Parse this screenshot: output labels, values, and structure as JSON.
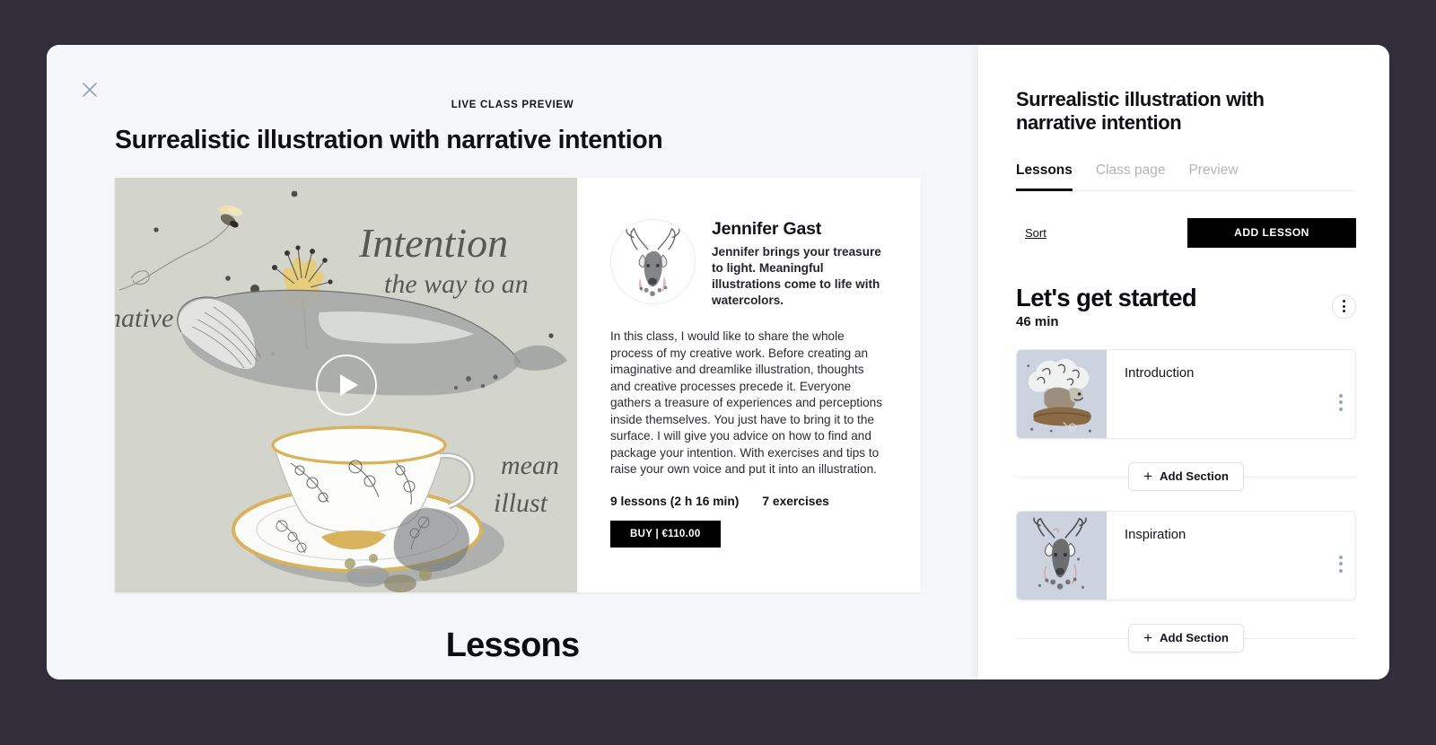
{
  "theme": {
    "page_background": "#312e3a",
    "modal_background": "#f4f6f9",
    "panel_background": "#ffffff",
    "accent": "#000000",
    "muted_text": "#b2b5bd",
    "hero_background": "#d3d4cc"
  },
  "preview": {
    "close_icon": "close-icon",
    "eyebrow": "LIVE CLASS PREVIEW",
    "title": "Surrealistic illustration with narrative intention",
    "hero": {
      "play_icon": "play-icon",
      "artwork_alt": "watercolor whale resting on a floral teacup with a bee and yellow flower",
      "handwritten_lines": [
        "Intention",
        "the way to an",
        "native",
        "mean",
        "illust"
      ]
    },
    "author": {
      "avatar_alt": "watercolor stag portrait",
      "name": "Jennifer Gast",
      "bio": "Jennifer brings your treasure to light. Meaningful illustrations come to life with watercolors."
    },
    "description": "In this class, I would like to share the whole process of my creative work. Before creating an imaginative and dreamlike illustration, thoughts and creative processes precede it. Everyone gathers a treasure of experiences and perceptions inside themselves. You just have to bring it to the surface. I will give you advice on how to find and package your intention. With exercises and tips to raise your own voice and put it into an illustration.",
    "stats": {
      "lessons": "9 lessons (2 h 16 min)",
      "exercises": "7 exercises"
    },
    "buy_label": "BUY | €110.00",
    "lessons_heading": "Lessons"
  },
  "side": {
    "title": "Surrealistic illustration with narrative intention",
    "tabs": [
      {
        "label": "Lessons",
        "active": true
      },
      {
        "label": "Class page",
        "active": false
      },
      {
        "label": "Preview",
        "active": false
      }
    ],
    "sort_label": "Sort",
    "add_lesson_label": "ADD LESSON",
    "section": {
      "name": "Let's get started",
      "duration": "46 min",
      "menu_icon": "kebab-menu-icon"
    },
    "lessons": [
      {
        "title": "Introduction",
        "thumb_alt": "watercolor fox on a log",
        "menu_icon": "kebab-menu-icon"
      },
      {
        "title": "Inspiration",
        "thumb_alt": "watercolor stag portrait",
        "menu_icon": "kebab-menu-icon"
      }
    ],
    "add_section_label": "Add Section",
    "add_section_icon": "plus-icon"
  }
}
